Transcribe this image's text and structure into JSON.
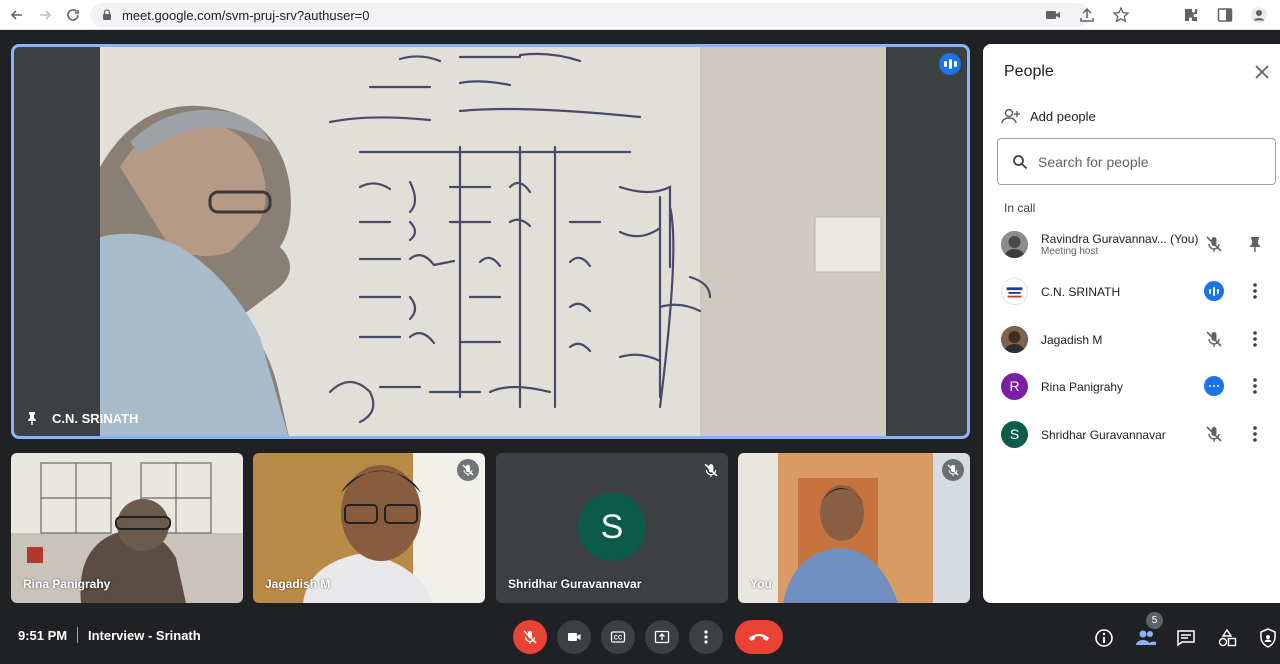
{
  "browser": {
    "url": "meet.google.com/svm-pruj-srv?authuser=0"
  },
  "stage": {
    "main_tile": {
      "name": "C.N. SRINATH"
    },
    "tiles": [
      {
        "name": "Rina Panigrahy"
      },
      {
        "name": "Jagadish M"
      },
      {
        "name": "Shridhar Guravannavar",
        "avatar_letter": "S"
      },
      {
        "name": "You"
      }
    ]
  },
  "people_panel": {
    "title": "People",
    "add_people": "Add people",
    "search_placeholder": "Search for people",
    "section": "In call",
    "people": [
      {
        "name": "Ravindra Guravannav... (You)",
        "sub": "Meeting host"
      },
      {
        "name": "C.N. SRINATH"
      },
      {
        "name": "Jagadish M"
      },
      {
        "name": "Rina Panigrahy",
        "avatar_letter": "R"
      },
      {
        "name": "Shridhar Guravannavar",
        "avatar_letter": "S"
      }
    ]
  },
  "bottom_bar": {
    "time": "9:51 PM",
    "meeting_name": "Interview - Srinath",
    "participant_count": "5"
  },
  "colors": {
    "accent_blue": "#1a73e8",
    "active_border": "#8ab4f8",
    "end_red": "#ea4335",
    "bg_dark": "#202124"
  }
}
